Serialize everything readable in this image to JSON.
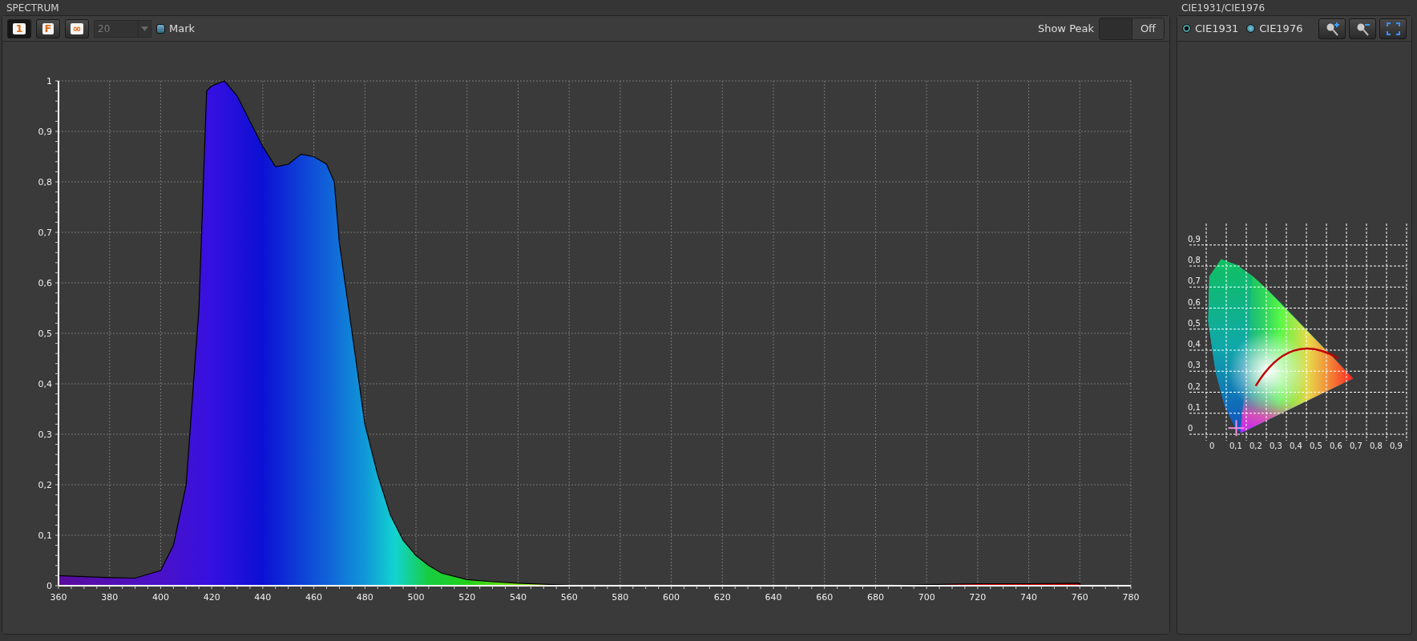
{
  "spectrum": {
    "title": "SPECTRUM",
    "toolbar": {
      "buttons": [
        {
          "label": "1",
          "selected": true
        },
        {
          "label": "F",
          "selected": false
        },
        {
          "label": "∞",
          "selected": false
        }
      ],
      "count": {
        "value": "20",
        "disabled": true
      },
      "mark": {
        "label": "Mark",
        "checked": false
      },
      "show_peak": {
        "label": "Show Peak",
        "value": "Off",
        "on": false
      }
    },
    "chart_data": {
      "type": "area",
      "x": [
        360,
        370,
        380,
        390,
        400,
        405,
        410,
        415,
        418,
        420,
        425,
        430,
        435,
        440,
        445,
        450,
        455,
        460,
        465,
        468,
        470,
        475,
        480,
        485,
        490,
        495,
        500,
        505,
        510,
        520,
        530,
        540,
        550,
        560,
        580,
        600,
        620,
        640,
        660,
        680,
        700,
        720,
        740,
        760
      ],
      "values": [
        0.02,
        0.018,
        0.016,
        0.015,
        0.03,
        0.08,
        0.2,
        0.55,
        0.98,
        0.99,
        1.0,
        0.97,
        0.92,
        0.87,
        0.83,
        0.835,
        0.855,
        0.85,
        0.835,
        0.8,
        0.68,
        0.5,
        0.32,
        0.22,
        0.14,
        0.09,
        0.06,
        0.04,
        0.025,
        0.012,
        0.008,
        0.005,
        0.003,
        0.001,
        0,
        0,
        0,
        0,
        0,
        0,
        0.002,
        0.004,
        0.004,
        0.005
      ],
      "xlim": [
        360,
        780
      ],
      "ylim": [
        0,
        1
      ],
      "grid": true,
      "xticks": [
        360,
        380,
        400,
        420,
        440,
        460,
        480,
        500,
        520,
        540,
        560,
        580,
        600,
        620,
        640,
        660,
        680,
        700,
        720,
        740,
        760,
        780
      ],
      "yticks": [
        {
          "value": 0,
          "label": "0"
        },
        {
          "value": 0.1,
          "label": "0,1"
        },
        {
          "value": 0.2,
          "label": "0,2"
        },
        {
          "value": 0.3,
          "label": "0,3"
        },
        {
          "value": 0.4,
          "label": "0,4"
        },
        {
          "value": 0.5,
          "label": "0,5"
        },
        {
          "value": 0.6,
          "label": "0,6"
        },
        {
          "value": 0.7,
          "label": "0,7"
        },
        {
          "value": 0.8,
          "label": "0,8"
        },
        {
          "value": 0.9,
          "label": "0,9"
        },
        {
          "value": 1,
          "label": "1"
        }
      ]
    }
  },
  "cie": {
    "title": "CIE1931/CIE1976",
    "modes": [
      {
        "label": "CIE1931",
        "selected": true
      },
      {
        "label": "CIE1976",
        "selected": false
      }
    ],
    "tools": [
      {
        "kind": "zoom-in"
      },
      {
        "kind": "zoom-out"
      },
      {
        "kind": "fit"
      }
    ],
    "x_ticks": [
      "0",
      "0,1",
      "0,2",
      "0,3",
      "0,4",
      "0,5",
      "0,6",
      "0,7",
      "0,8",
      "0,9"
    ],
    "y_ticks": [
      "0,9",
      "0,8",
      "0,7",
      "0,6",
      "0,5",
      "0,4",
      "0,3",
      "0,2",
      "0,1",
      "0"
    ]
  }
}
